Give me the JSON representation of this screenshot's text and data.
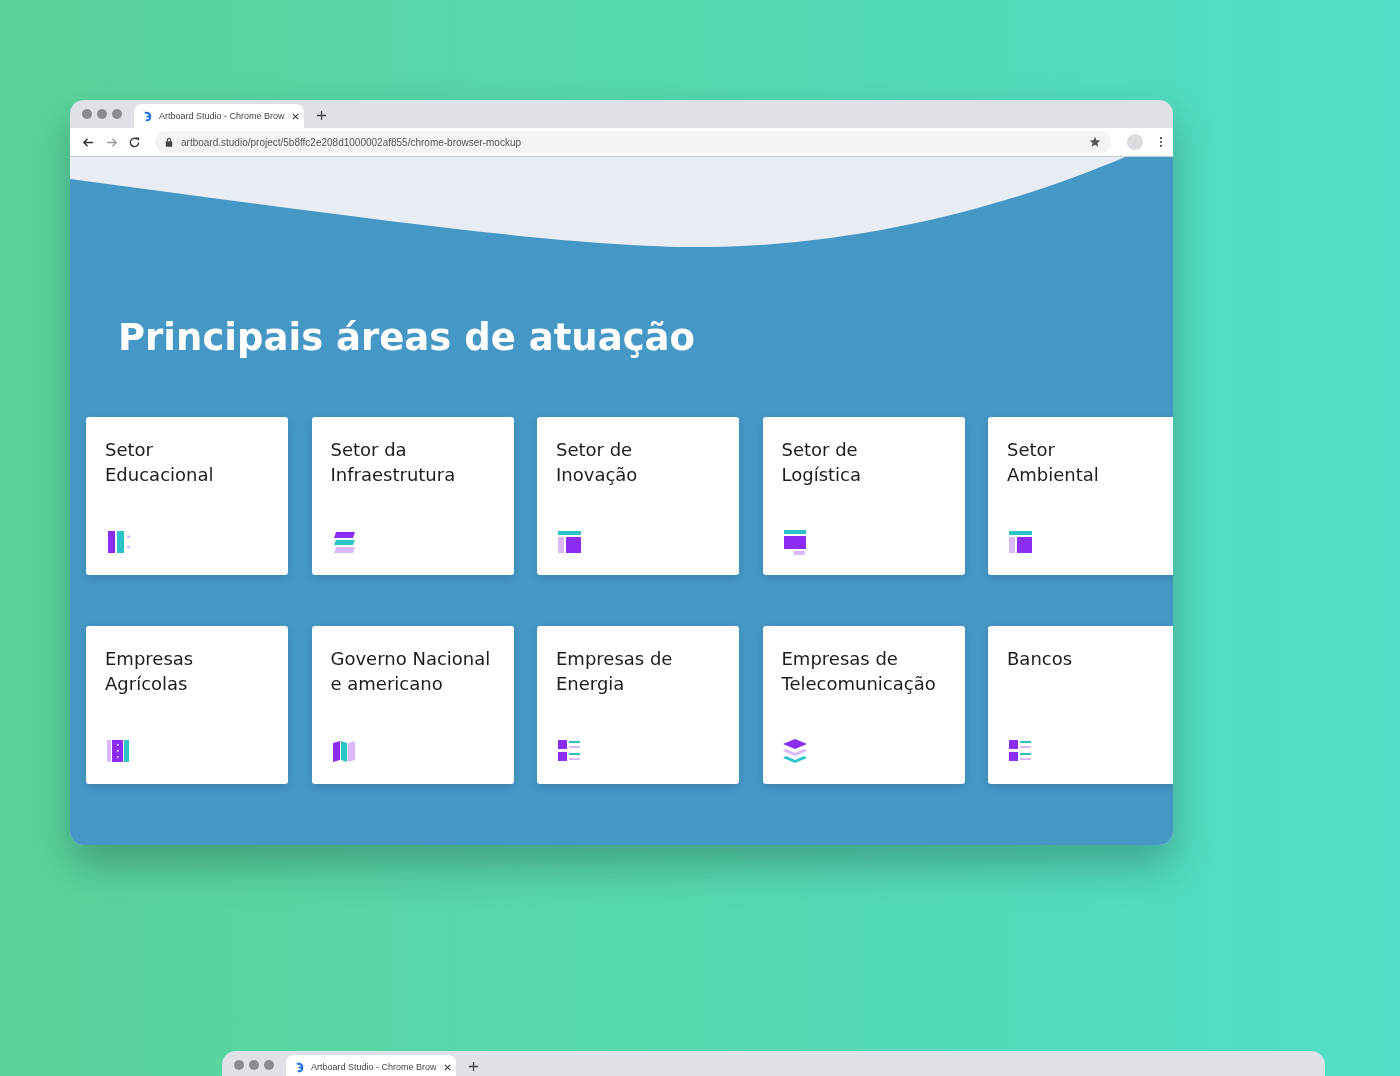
{
  "browser": {
    "tab": {
      "title": "Artboard Studio - Chrome Brow"
    },
    "address": "artboard.studio/project/5b8ffc2e208d1000002af855/chrome-browser-mockup"
  },
  "page": {
    "heading": "Principais áreas de atuação",
    "cards": [
      {
        "lines": [
          "Setor",
          "Educacional"
        ]
      },
      {
        "lines": [
          "Setor da",
          "Infraestrutura"
        ]
      },
      {
        "lines": [
          "Setor de",
          "Inovação"
        ]
      },
      {
        "lines": [
          "Setor de",
          "Logística"
        ]
      },
      {
        "lines": [
          "Setor",
          "Ambiental"
        ]
      },
      {
        "lines": [
          "Empresas",
          "Agrícolas"
        ]
      },
      {
        "lines": [
          "Governo Nacional",
          "e americano"
        ]
      },
      {
        "lines": [
          "Empresas de",
          "Energia"
        ]
      },
      {
        "lines": [
          "Empresas de",
          "Telecomunicação"
        ]
      },
      {
        "lines": [
          "Bancos"
        ]
      }
    ]
  },
  "second_browser": {
    "tab": {
      "title": "Artboard Studio - Chrome Brow"
    }
  }
}
